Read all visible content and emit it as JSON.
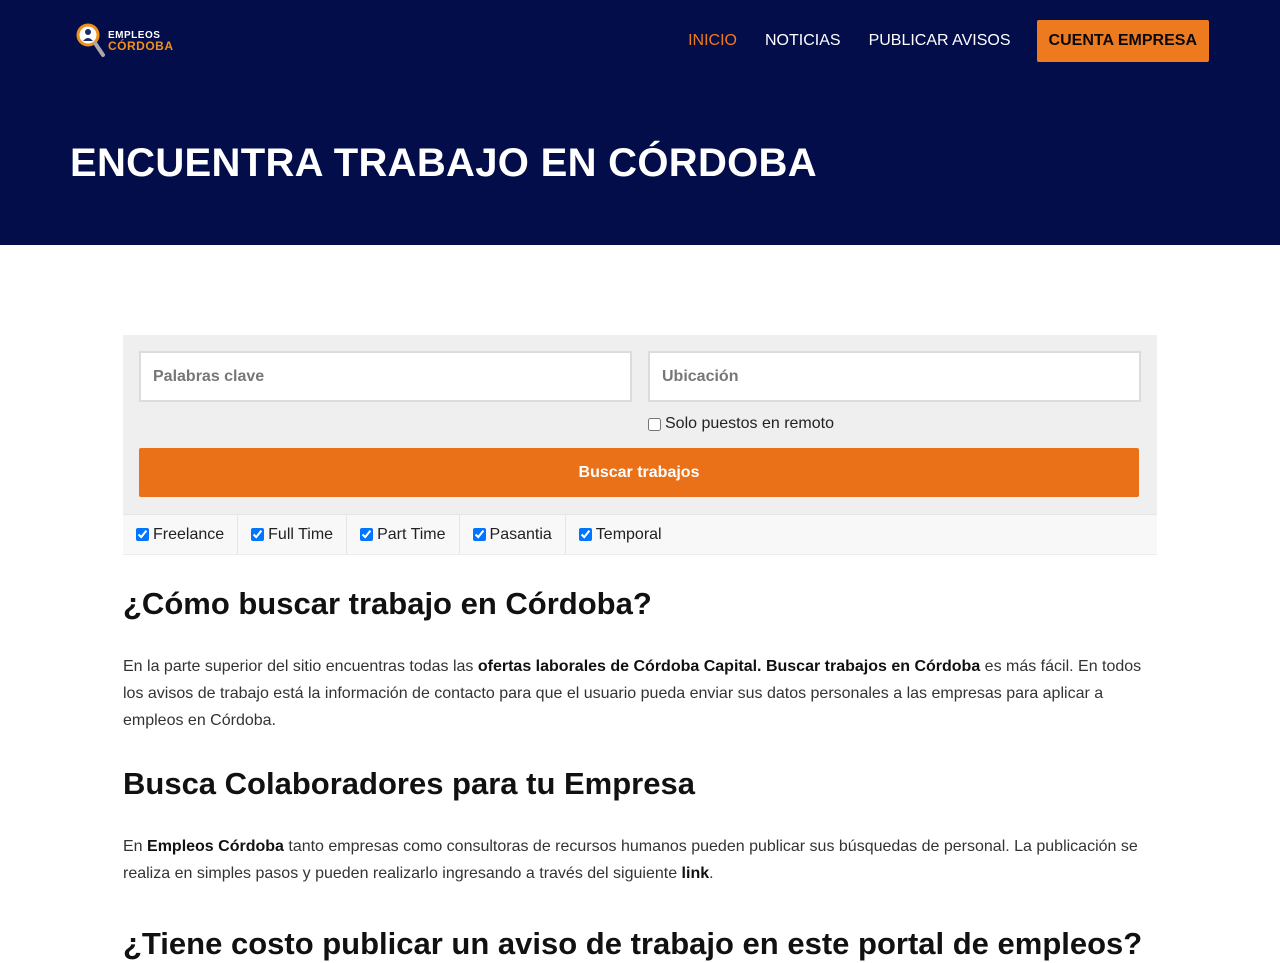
{
  "logo": {
    "line1": "EMPLEOS",
    "line2": "CÓRDOBA",
    "icon": "magnifier-person-icon"
  },
  "nav": {
    "items": [
      {
        "label": "INICIO",
        "active": true
      },
      {
        "label": "NOTICIAS",
        "active": false
      },
      {
        "label": "PUBLICAR AVISOS",
        "active": false
      }
    ],
    "cta": "CUENTA EMPRESA"
  },
  "hero": {
    "title": "ENCUENTRA TRABAJO EN CÓRDOBA"
  },
  "search": {
    "keywords_placeholder": "Palabras clave",
    "location_placeholder": "Ubicación",
    "remote_label": "Solo puestos en remoto",
    "remote_checked": false,
    "button_label": "Buscar trabajos"
  },
  "job_types": [
    {
      "label": "Freelance",
      "checked": true
    },
    {
      "label": "Full Time",
      "checked": true
    },
    {
      "label": "Part Time",
      "checked": true
    },
    {
      "label": "Pasantia",
      "checked": true
    },
    {
      "label": "Temporal",
      "checked": true
    }
  ],
  "sections": {
    "s1_title": "¿Cómo buscar trabajo en Córdoba?",
    "s1_t1": "En la parte superior del sitio encuentras todas las ",
    "s1_b1": "ofertas laborales de Córdoba Capital. Buscar trabajos en Córdoba",
    "s1_t2": " es más fácil. En todos los avisos de trabajo está la información de contacto para que el usuario pueda enviar sus datos personales a las empresas para aplicar a empleos en Córdoba.",
    "s2_title": "Busca Colaboradores para tu Empresa",
    "s2_t1": "En ",
    "s2_b1": "Empleos Córdoba",
    "s2_t2": " tanto empresas como consultoras de recursos humanos pueden publicar sus búsquedas de personal. La publicación se realiza en simples pasos y pueden realizarlo ingresando a través del siguiente ",
    "s2_link": "link",
    "s2_t3": ".",
    "s3_title": "¿Tiene costo publicar un aviso de trabajo en este portal de empleos?"
  },
  "colors": {
    "header_bg": "#020d4a",
    "accent": "#ea7118"
  }
}
